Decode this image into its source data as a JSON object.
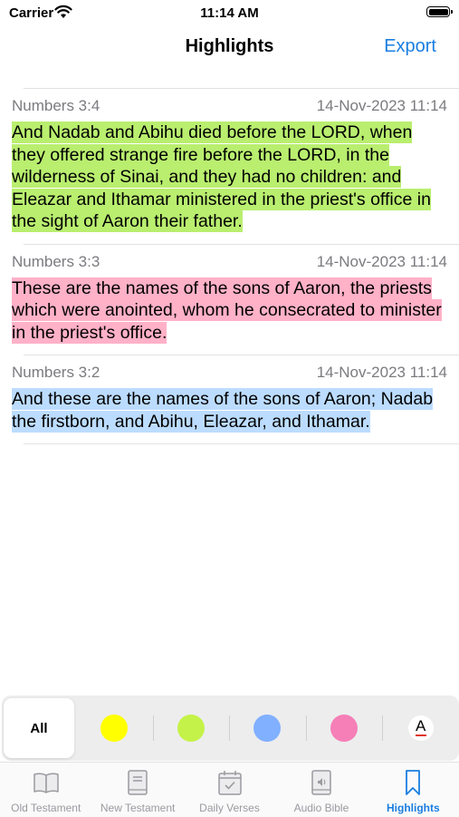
{
  "status_bar": {
    "carrier": "Carrier",
    "time": "11:14 AM"
  },
  "nav": {
    "title": "Highlights",
    "export_label": "Export"
  },
  "highlights": [
    {
      "reference": "Numbers 3:4",
      "timestamp": "14-Nov-2023 11:14",
      "text": "And Nadab and Abihu died before the LORD, when they offered strange fire before the LORD, in the wilderness of Sinai, and they had no children: and Eleazar and Ithamar ministered in the priest's office in the sight of Aaron their father.",
      "color": "#b9ee6f"
    },
    {
      "reference": "Numbers 3:3",
      "timestamp": "14-Nov-2023 11:14",
      "text": "These are the names of the sons of Aaron, the priests which were anointed, whom he consecrated to minister in the priest's office.",
      "color": "#ffb1c8"
    },
    {
      "reference": "Numbers 3:2",
      "timestamp": "14-Nov-2023 11:14",
      "text": "And these are the names of the sons of Aaron; Nadab the firstborn, and Abihu, Eleazar, and Ithamar.",
      "color": "#bcdcff"
    }
  ],
  "color_filter": {
    "all_label": "All",
    "colors": [
      "#ffff00",
      "#c5f248",
      "#80b0ff",
      "#f57fb6"
    ],
    "font_icon_label": "A"
  },
  "tab_bar": {
    "tabs": [
      {
        "label": "Old Testament",
        "icon": "book-open-icon",
        "active": false
      },
      {
        "label": "New Testament",
        "icon": "book-icon",
        "active": false
      },
      {
        "label": "Daily Verses",
        "icon": "calendar-check-icon",
        "active": false
      },
      {
        "label": "Audio Bible",
        "icon": "speaker-book-icon",
        "active": false
      },
      {
        "label": "Highlights",
        "icon": "bookmark-icon",
        "active": true
      }
    ],
    "active_color": "#1a7ee0"
  }
}
